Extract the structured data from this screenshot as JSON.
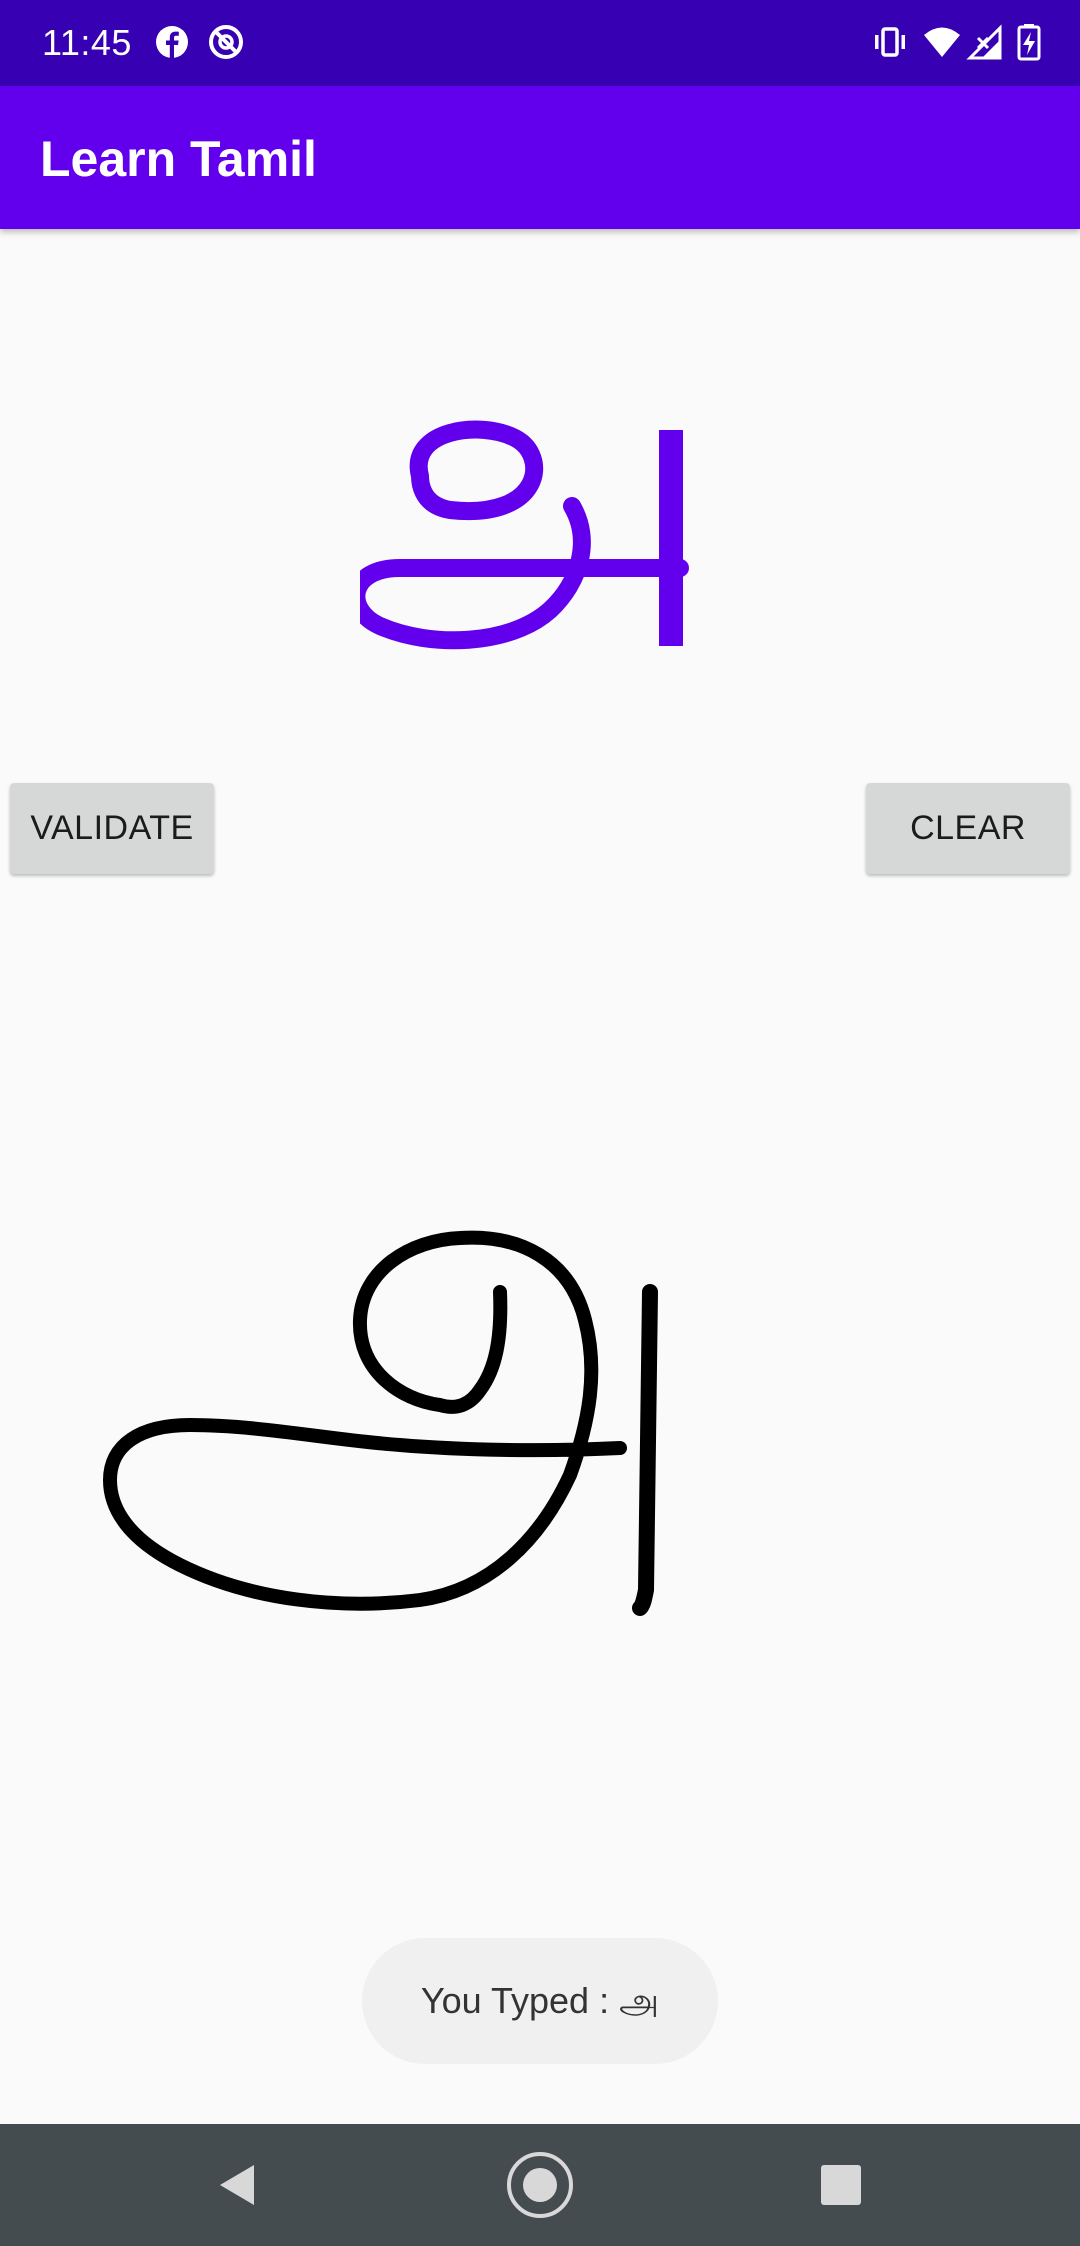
{
  "status_bar": {
    "time": "11:45",
    "left_icons": [
      "facebook-icon",
      "no-disturb-icon"
    ],
    "right_icons": [
      "vibrate-icon",
      "wifi-icon",
      "signal-icon",
      "battery-charging-icon"
    ]
  },
  "app_bar": {
    "title": "Learn Tamil"
  },
  "target": {
    "letter": "அ",
    "color": "#6200ee"
  },
  "buttons": {
    "validate_label": "VALIDATE",
    "clear_label": "CLEAR"
  },
  "drawing": {
    "stroke_color": "#000000"
  },
  "toast": {
    "text": "You Typed : அ"
  },
  "nav_bar": {
    "icons": [
      "back-icon",
      "home-icon",
      "recents-icon"
    ]
  },
  "colors": {
    "status_bar": "#3700b3",
    "app_bar": "#6200ee",
    "background": "#fafafa",
    "button": "#d6d7d7",
    "nav_bar": "#454c50"
  }
}
